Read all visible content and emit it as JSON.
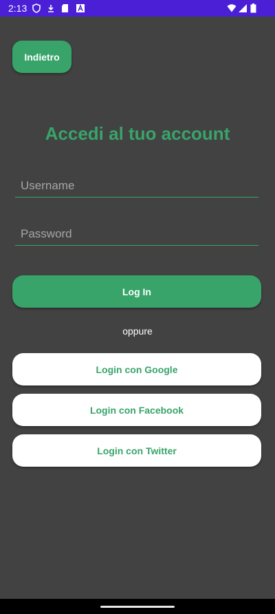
{
  "status_bar": {
    "time": "2:13",
    "background_color": "#4a1fd6",
    "icons": [
      "shield-icon",
      "download-icon",
      "sd-card-icon",
      "font-icon",
      "wifi-icon",
      "signal-icon",
      "battery-icon"
    ]
  },
  "header": {
    "back_label": "Indietro"
  },
  "main": {
    "title": "Accedi al tuo account",
    "username_placeholder": "Username",
    "username_value": "",
    "password_placeholder": "Password",
    "password_value": "",
    "login_label": "Log In",
    "or_text": "oppure",
    "google_label": "Login con Google",
    "facebook_label": "Login con Facebook",
    "twitter_label": "Login con Twitter"
  },
  "colors": {
    "accent": "#38a46a",
    "background": "#424242",
    "button_text_light": "#ffffff",
    "social_button_bg": "#ffffff"
  }
}
